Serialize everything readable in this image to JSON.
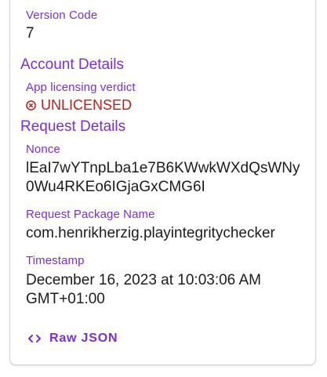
{
  "version_code": {
    "label": "Version Code",
    "value": "7"
  },
  "account_details": {
    "title": "Account Details",
    "licensing_label": "App licensing verdict",
    "verdict_icon": "cancel-circle-icon",
    "verdict": "UNLICENSED"
  },
  "request_details": {
    "title": "Request Details",
    "nonce_label": "Nonce",
    "nonce_line1": "lEaI7wYTnpLba1e7B6KWwkWXdQsWNy",
    "nonce_line2": "0Wu4RKEo6IGjaGxCMG6I",
    "package_label": "Request Package Name",
    "package_value": "com.henrikherzig.playintegritychecker",
    "timestamp_label": "Timestamp",
    "timestamp_line1": "December 16, 2023 at 10:03:06 AM",
    "timestamp_line2": "GMT+01:00"
  },
  "raw_json_button": {
    "icon": "code-icon",
    "label": "Raw JSON"
  },
  "colors": {
    "accent": "#7b2fd6",
    "error": "#c21b1b",
    "text": "#1c1c1c"
  }
}
